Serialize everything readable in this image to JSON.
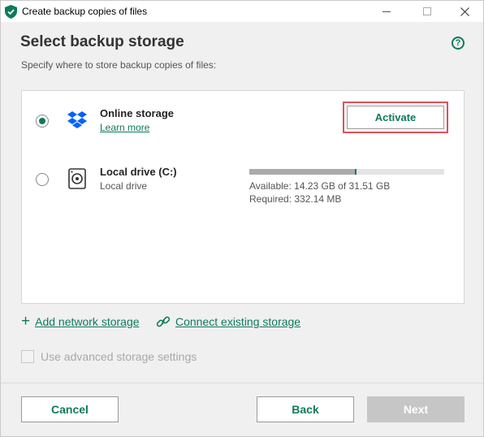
{
  "window": {
    "title": "Create backup copies of files"
  },
  "header": {
    "title": "Select backup storage",
    "subtitle": "Specify where to store backup copies of files:",
    "help_glyph": "?"
  },
  "storage_options": {
    "online": {
      "title": "Online storage",
      "link": "Learn more",
      "action": "Activate",
      "selected": true,
      "icon": "dropbox-icon"
    },
    "local": {
      "title": "Local drive (C:)",
      "subtitle": "Local drive",
      "available": "Available: 14.23 GB of 31.51 GB",
      "required": "Required: 332.14 MB",
      "used_fraction": 0.55,
      "selected": false,
      "icon": "hard-drive-icon"
    }
  },
  "links": {
    "add_network": "Add network storage",
    "connect_existing": "Connect existing storage"
  },
  "advanced": {
    "label": "Use advanced storage settings",
    "checked": false,
    "enabled": false
  },
  "footer": {
    "cancel": "Cancel",
    "back": "Back",
    "next": "Next"
  },
  "colors": {
    "accent": "#0e7a5c",
    "highlight_border": "#e0505a",
    "disabled_button": "#c6c6c6"
  }
}
